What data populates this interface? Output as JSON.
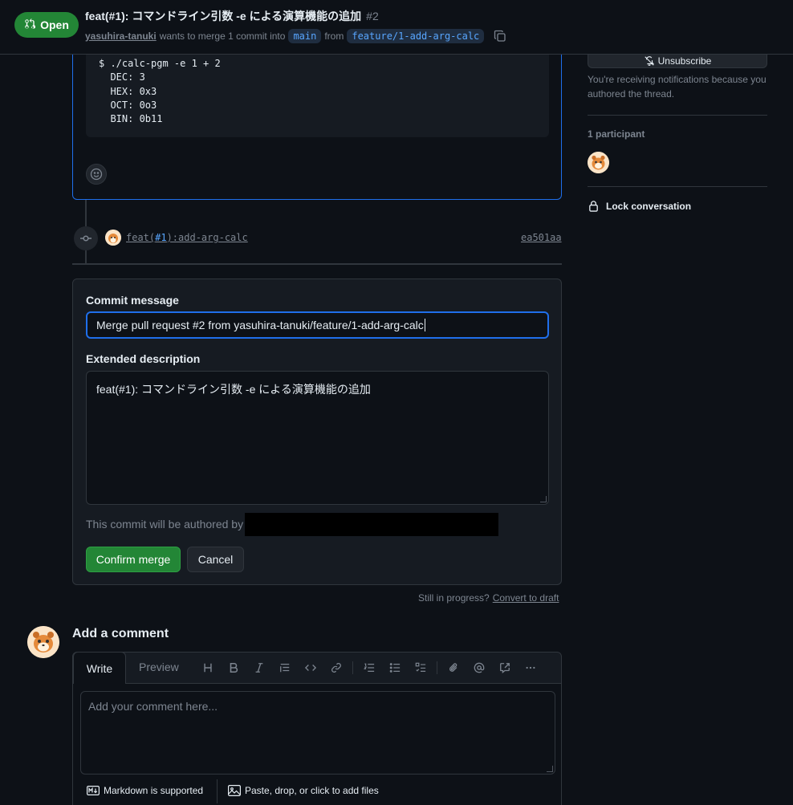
{
  "header": {
    "state": "Open",
    "title": "feat(#1): コマンドライン引数 -e による演算機能の追加",
    "number": "#2",
    "author": "yasuhira-tanuki",
    "merge_text": "wants to merge 1 commit into",
    "base_branch": "main",
    "from_text": "from",
    "head_branch": "feature/1-add-arg-calc"
  },
  "description": {
    "code": "$ ./calc-pgm -e 1 + 2\n  DEC: 3\n  HEX: 0x3\n  OCT: 0o3\n  BIN: 0b11"
  },
  "commit": {
    "message_prefix": "feat(",
    "message_issue": "#1",
    "message_suffix": "):add-arg-calc",
    "sha": "ea501aa"
  },
  "merge": {
    "commit_message_label": "Commit message",
    "commit_message_value": "Merge pull request #2 from yasuhira-tanuki/feature/1-add-arg-calc",
    "extended_label": "Extended description",
    "extended_value": "feat(#1): コマンドライン引数 -e による演算機能の追加",
    "authored_by_text": "This commit will be authored by",
    "confirm_label": "Confirm merge",
    "cancel_label": "Cancel"
  },
  "draft": {
    "text": "Still in progress?",
    "link": "Convert to draft"
  },
  "comment": {
    "heading": "Add a comment",
    "tab_write": "Write",
    "tab_preview": "Preview",
    "placeholder": "Add your comment here...",
    "markdown_note": "Markdown is supported",
    "files_note": "Paste, drop, or click to add files"
  },
  "sidebar": {
    "unsubscribe_label": "Unsubscribe",
    "notification_text": "You're receiving notifications because you authored the thread.",
    "participants_label": "1 participant",
    "lock_label": "Lock conversation"
  }
}
